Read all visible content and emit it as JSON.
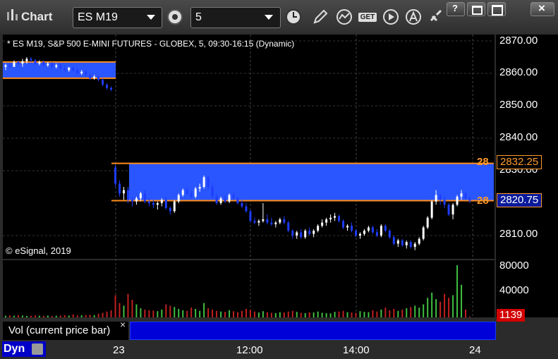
{
  "window": {
    "title": "Chart",
    "symbol": "ES M19",
    "interval": "5",
    "controls": [
      "help-icon",
      "restore-icon",
      "maximize-icon",
      "close-icon"
    ]
  },
  "toolbar": {
    "icons": [
      "settings-gear-icon",
      "clock-icon",
      "pencil-icon",
      "chart-study-icon",
      "get-icon",
      "play-icon",
      "alert-icon",
      "link-icon"
    ],
    "get_label": "GET"
  },
  "chart_info": "* ES M19, S&P 500 E-MINI FUTURES - GLOBEX, 5, 09:30-16:15 (Dynamic)",
  "copyright": "© eSignal, 2019",
  "price_axis": {
    "ticks": [
      "2870.00",
      "2860.00",
      "2850.00",
      "2840.00",
      "2830.00",
      "2810.00"
    ]
  },
  "markers": {
    "upper_value": "2832.25",
    "upper_stub": "28",
    "lower_value": "2820.75",
    "lower_stub": "28",
    "volume_value": "1139"
  },
  "volume_axis": {
    "ticks": [
      "80000",
      "40000"
    ]
  },
  "volume_study_label": "Vol (current price bar)",
  "x_axis": {
    "ticks": [
      "23",
      "12:00",
      "14:00",
      "24"
    ]
  },
  "footer": {
    "mode_label": "Dyn"
  },
  "colors": {
    "background": "#000000",
    "zone": "#2a56ff",
    "zone_line": "#ff8c1a",
    "volume_marker": "#d20000",
    "up_candle": "#ffffff",
    "down_candle": "#1f3dff"
  },
  "chart_data": {
    "type": "candlestick",
    "ylim": [
      2800,
      2872
    ],
    "zones": [
      {
        "from_bar": 0,
        "to_bar": 26,
        "low": 2858.5,
        "high": 2863.5
      },
      {
        "from_bar": 26,
        "to_bar": 112,
        "low": 2820.75,
        "high": 2832.25
      }
    ],
    "bars": [
      [
        2862,
        2863,
        2861,
        2862.5
      ],
      [
        2862.5,
        2863,
        2861.5,
        2862
      ],
      [
        2862,
        2864,
        2862,
        2863.5
      ],
      [
        2863.5,
        2864,
        2862.5,
        2863
      ],
      [
        2863,
        2864.5,
        2862,
        2863.75
      ],
      [
        2863.75,
        2865,
        2863,
        2864.5
      ],
      [
        2864.5,
        2865,
        2863.5,
        2864
      ],
      [
        2864,
        2864.5,
        2862.5,
        2863
      ],
      [
        2863,
        2864,
        2862.5,
        2863.5
      ],
      [
        2863.5,
        2864,
        2862,
        2862.5
      ],
      [
        2862.5,
        2863.5,
        2862,
        2863
      ],
      [
        2863,
        2863.5,
        2861.5,
        2862
      ],
      [
        2862,
        2863,
        2861.5,
        2862.5
      ],
      [
        2862.5,
        2863,
        2861,
        2861.5
      ],
      [
        2861.5,
        2862.5,
        2860.5,
        2861
      ],
      [
        2861,
        2862,
        2860.5,
        2861.75
      ],
      [
        2861.75,
        2862,
        2860.5,
        2861
      ],
      [
        2861,
        2861.5,
        2859.5,
        2860
      ],
      [
        2860,
        2861,
        2859.5,
        2860.5
      ],
      [
        2860.5,
        2861,
        2859,
        2859.5
      ],
      [
        2859.5,
        2860,
        2858,
        2858.5
      ],
      [
        2858.5,
        2859.5,
        2858,
        2859
      ],
      [
        2859,
        2859.5,
        2857.5,
        2858
      ],
      [
        2858,
        2858.5,
        2856,
        2856.5
      ],
      [
        2856.5,
        2857,
        2855,
        2855.5
      ],
      [
        2855.5,
        2856,
        2854.5,
        2855
      ],
      [
        2831,
        2832,
        2825,
        2826
      ],
      [
        2826,
        2827,
        2822,
        2823
      ],
      [
        2823,
        2825,
        2821,
        2824
      ],
      [
        2824,
        2825,
        2820,
        2821
      ],
      [
        2821,
        2822,
        2819,
        2820.5
      ],
      [
        2820.5,
        2822,
        2819.5,
        2821.5
      ],
      [
        2821.5,
        2823.5,
        2820.5,
        2823
      ],
      [
        2823,
        2824,
        2820,
        2820.5
      ],
      [
        2820.5,
        2821.5,
        2819,
        2820
      ],
      [
        2820,
        2821,
        2818.5,
        2819.5
      ],
      [
        2819.5,
        2820.5,
        2818,
        2820
      ],
      [
        2820,
        2821.5,
        2819,
        2821
      ],
      [
        2821,
        2822,
        2818,
        2818.5
      ],
      [
        2818.5,
        2819,
        2816.5,
        2817.5
      ],
      [
        2817.5,
        2821,
        2817,
        2820.5
      ],
      [
        2820.5,
        2823,
        2820,
        2822.5
      ],
      [
        2822.5,
        2824.5,
        2822,
        2824
      ],
      [
        2824,
        2825,
        2822.5,
        2823
      ],
      [
        2823,
        2824,
        2821.5,
        2822
      ],
      [
        2822,
        2825,
        2821.5,
        2824.5
      ],
      [
        2824.5,
        2826,
        2823.5,
        2825
      ],
      [
        2825,
        2828.5,
        2824.5,
        2828
      ],
      [
        2828,
        2828.5,
        2824,
        2825
      ],
      [
        2825,
        2826,
        2821.5,
        2822
      ],
      [
        2822,
        2823,
        2819.5,
        2820
      ],
      [
        2820,
        2822,
        2819.5,
        2821.5
      ],
      [
        2821.5,
        2822.5,
        2820,
        2820.5
      ],
      [
        2820.5,
        2823,
        2820,
        2822.5
      ],
      [
        2822.5,
        2823.5,
        2821,
        2821.5
      ],
      [
        2821.5,
        2822,
        2819.5,
        2820
      ],
      [
        2820,
        2821,
        2818.5,
        2819
      ],
      [
        2819,
        2820,
        2817,
        2817.5
      ],
      [
        2817.5,
        2818,
        2814,
        2814.5
      ],
      [
        2814.5,
        2815.5,
        2813.5,
        2814
      ],
      [
        2814,
        2815,
        2813,
        2814.5
      ],
      [
        2814.5,
        2820,
        2814,
        2815
      ],
      [
        2815,
        2816.5,
        2813.5,
        2814
      ],
      [
        2814,
        2815.5,
        2813,
        2813.5
      ],
      [
        2813.5,
        2814.5,
        2812.5,
        2814
      ],
      [
        2814,
        2815.5,
        2813.5,
        2815
      ],
      [
        2815,
        2816,
        2813.5,
        2814
      ],
      [
        2814,
        2814.5,
        2811,
        2811.5
      ],
      [
        2811.5,
        2812,
        2809,
        2810
      ],
      [
        2810,
        2811.5,
        2809,
        2811
      ],
      [
        2811,
        2812,
        2809,
        2809.5
      ],
      [
        2809.5,
        2812,
        2809,
        2811.5
      ],
      [
        2811.5,
        2812.5,
        2810,
        2810.5
      ],
      [
        2810.5,
        2812,
        2809.5,
        2811.5
      ],
      [
        2811.5,
        2813.5,
        2811,
        2813
      ],
      [
        2813,
        2815,
        2812.5,
        2814
      ],
      [
        2814,
        2815.5,
        2813,
        2815
      ],
      [
        2815,
        2816.5,
        2814,
        2815.5
      ],
      [
        2815.5,
        2817,
        2814.5,
        2816
      ],
      [
        2816,
        2816.5,
        2814,
        2814.5
      ],
      [
        2814.5,
        2815,
        2812,
        2812.5
      ],
      [
        2812.5,
        2813.5,
        2811.5,
        2813
      ],
      [
        2813,
        2814,
        2811,
        2811.5
      ],
      [
        2811.5,
        2812,
        2809.5,
        2810
      ],
      [
        2810,
        2811,
        2809,
        2810.5
      ],
      [
        2810.5,
        2812,
        2810,
        2811.5
      ],
      [
        2811.5,
        2813,
        2811,
        2812.5
      ],
      [
        2812.5,
        2813,
        2810.5,
        2811
      ],
      [
        2811,
        2812,
        2809.5,
        2810
      ],
      [
        2810,
        2813.5,
        2809.5,
        2813
      ],
      [
        2813,
        2813.5,
        2811,
        2811.5
      ],
      [
        2811.5,
        2812,
        2809,
        2809.5
      ],
      [
        2809.5,
        2810,
        2807,
        2807.5
      ],
      [
        2807.5,
        2809,
        2806.5,
        2808.5
      ],
      [
        2808.5,
        2809,
        2806.5,
        2807
      ],
      [
        2807,
        2808.5,
        2806,
        2808
      ],
      [
        2808,
        2808.5,
        2806,
        2806.5
      ],
      [
        2806.5,
        2808,
        2805.5,
        2807.5
      ],
      [
        2807.5,
        2809.5,
        2807,
        2809
      ],
      [
        2809,
        2813,
        2808.5,
        2812.5
      ],
      [
        2812.5,
        2816,
        2812,
        2815.5
      ],
      [
        2815.5,
        2821,
        2815,
        2820.5
      ],
      [
        2820.5,
        2824,
        2819.5,
        2822.5
      ],
      [
        2822.5,
        2823,
        2819.5,
        2821
      ],
      [
        2821,
        2822,
        2818.5,
        2819.5
      ],
      [
        2819.5,
        2820,
        2816,
        2816.5
      ],
      [
        2816.5,
        2820,
        2815,
        2819.5
      ],
      [
        2819.5,
        2822.5,
        2819,
        2822
      ],
      [
        2822,
        2824,
        2821,
        2823
      ],
      [
        2823,
        2823.5,
        2821,
        2821.5
      ],
      [
        2821.5,
        2822,
        2820,
        2820.75
      ]
    ],
    "volume": [
      2500,
      3000,
      2500,
      3500,
      2800,
      2200,
      2600,
      3000,
      2500,
      2400,
      2800,
      2200,
      2600,
      3000,
      3500,
      2800,
      4500,
      3000,
      3200,
      3800,
      4000,
      3500,
      5500,
      7000,
      9000,
      11000,
      34000,
      22000,
      18000,
      36000,
      27000,
      20000,
      14000,
      12000,
      11000,
      10500,
      9500,
      12000,
      20000,
      18000,
      16000,
      13000,
      11000,
      10000,
      15000,
      13000,
      10000,
      22000,
      14000,
      12000,
      10000,
      9000,
      8500,
      11000,
      9500,
      8000,
      10000,
      13000,
      12000,
      9000,
      7500,
      9500,
      8000,
      7000,
      6500,
      8000,
      7500,
      9000,
      10000,
      8500,
      7000,
      6500,
      8000,
      7500,
      9000,
      7000,
      6500,
      6000,
      8500,
      9000,
      10000,
      8000,
      7500,
      7000,
      9500,
      8500,
      8000,
      11000,
      9000,
      12000,
      15000,
      11000,
      13000,
      10000,
      12000,
      14000,
      16000,
      18000,
      15000,
      20000,
      30000,
      38000,
      28000,
      24000,
      36000,
      30000,
      34000,
      80000,
      50000,
      12000,
      1139
    ]
  }
}
